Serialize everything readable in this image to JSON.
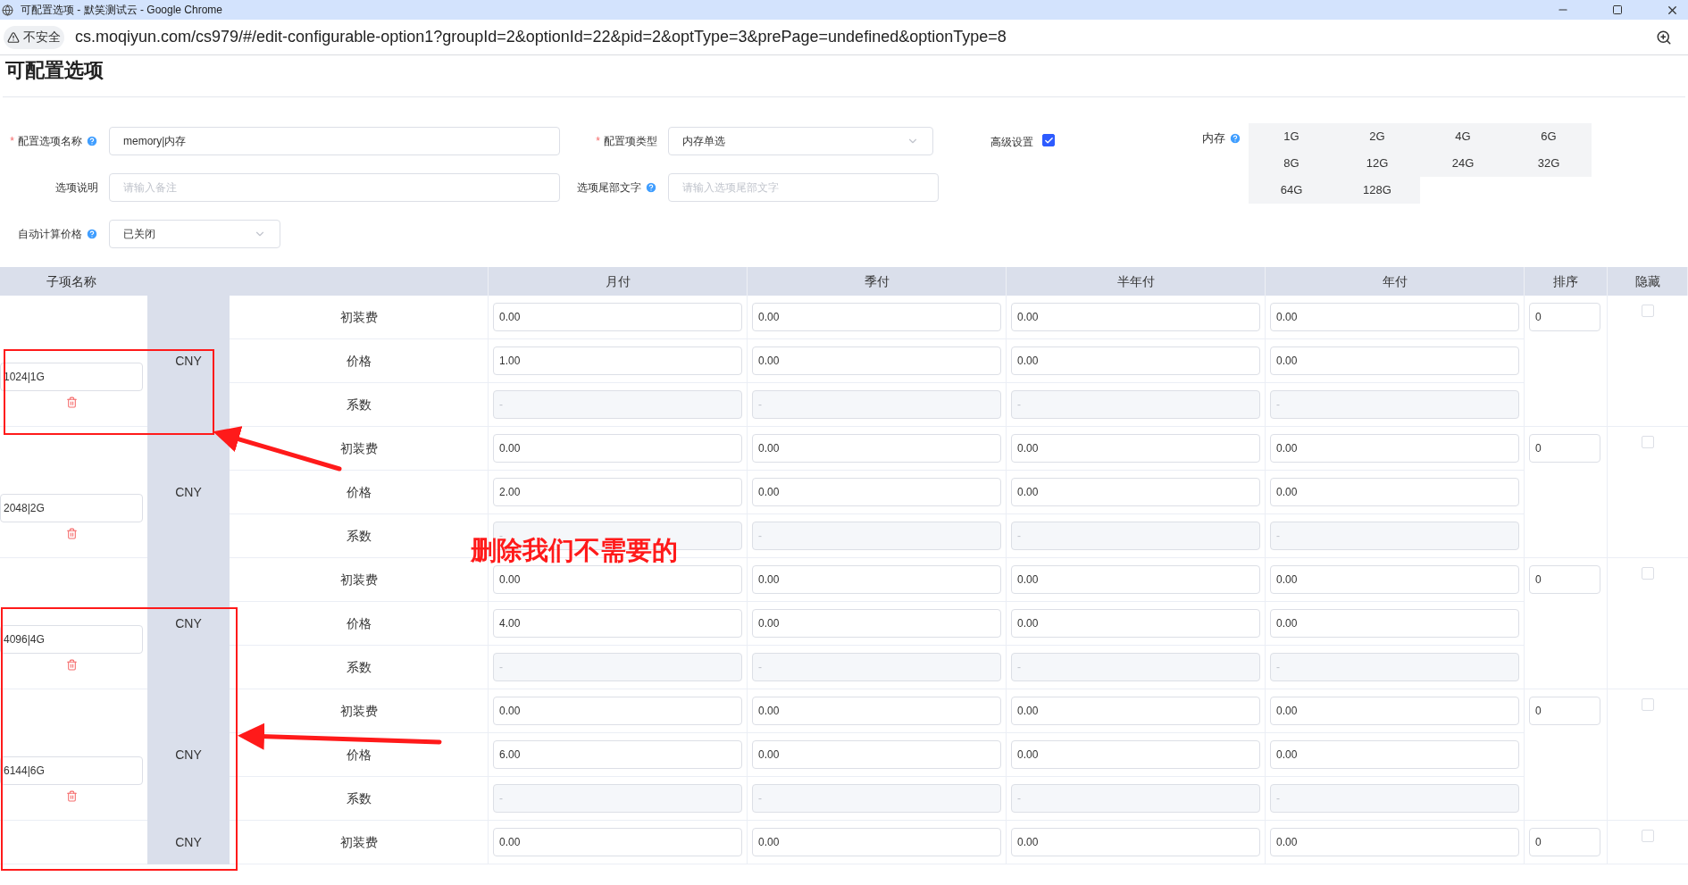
{
  "window": {
    "title": "可配置选项 - 默笑测试云 - Google Chrome"
  },
  "address_bar": {
    "security": "不安全",
    "url": "cs.moqiyun.com/cs979/#/edit-configurable-option1?groupId=2&optionId=22&pid=2&optType=3&prePage=undefined&optionType=8"
  },
  "page_title": "可配置选项",
  "form": {
    "name": {
      "label": "配置选项名称",
      "required_mark": "*",
      "value": "memory|内存"
    },
    "type": {
      "label": "配置项类型",
      "required_mark": "*",
      "value": "内存单选"
    },
    "advanced": {
      "label": "高级设置",
      "checked": true
    },
    "memory": {
      "label": "内存",
      "options": [
        "1G",
        "2G",
        "4G",
        "6G",
        "8G",
        "12G",
        "24G",
        "32G",
        "64G",
        "128G"
      ]
    },
    "description": {
      "label": "选项说明",
      "placeholder": "请输入备注"
    },
    "suffix": {
      "label": "选项尾部文字",
      "placeholder": "请输入选项尾部文字"
    },
    "auto_price": {
      "label": "自动计算价格",
      "value": "已关闭"
    }
  },
  "table": {
    "columns": [
      "子项名称",
      "月付",
      "季付",
      "半年付",
      "年付",
      "排序",
      "隐藏"
    ],
    "items": [
      {
        "name": "1024|1G",
        "currency": "CNY",
        "sort": "0",
        "hidden": false,
        "rows": [
          {
            "label": "初装费",
            "disabled": false,
            "values": [
              "0.00",
              "0.00",
              "0.00",
              "0.00"
            ]
          },
          {
            "label": "价格",
            "disabled": false,
            "values": [
              "1.00",
              "0.00",
              "0.00",
              "0.00"
            ]
          },
          {
            "label": "系数",
            "disabled": true,
            "values": [
              "-",
              "-",
              "-",
              "-"
            ]
          }
        ]
      },
      {
        "name": "2048|2G",
        "currency": "CNY",
        "sort": "0",
        "hidden": false,
        "rows": [
          {
            "label": "初装费",
            "disabled": false,
            "values": [
              "0.00",
              "0.00",
              "0.00",
              "0.00"
            ]
          },
          {
            "label": "价格",
            "disabled": false,
            "values": [
              "2.00",
              "0.00",
              "0.00",
              "0.00"
            ]
          },
          {
            "label": "系数",
            "disabled": true,
            "values": [
              "-",
              "-",
              "-",
              "-"
            ]
          }
        ]
      },
      {
        "name": "4096|4G",
        "currency": "CNY",
        "sort": "0",
        "hidden": false,
        "rows": [
          {
            "label": "初装费",
            "disabled": false,
            "values": [
              "0.00",
              "0.00",
              "0.00",
              "0.00"
            ]
          },
          {
            "label": "价格",
            "disabled": false,
            "values": [
              "4.00",
              "0.00",
              "0.00",
              "0.00"
            ]
          },
          {
            "label": "系数",
            "disabled": true,
            "values": [
              "-",
              "-",
              "-",
              "-"
            ]
          }
        ]
      },
      {
        "name": "6144|6G",
        "currency": "CNY",
        "sort": "0",
        "hidden": false,
        "rows": [
          {
            "label": "初装费",
            "disabled": false,
            "values": [
              "0.00",
              "0.00",
              "0.00",
              "0.00"
            ]
          },
          {
            "label": "价格",
            "disabled": false,
            "values": [
              "6.00",
              "0.00",
              "0.00",
              "0.00"
            ]
          },
          {
            "label": "系数",
            "disabled": true,
            "values": [
              "-",
              "-",
              "-",
              "-"
            ]
          }
        ]
      },
      {
        "currency": "CNY",
        "sort": "0",
        "hidden": false,
        "rows": [
          {
            "label": "初装费",
            "disabled": false,
            "values": [
              "0.00",
              "0.00",
              "0.00",
              "0.00"
            ]
          }
        ]
      }
    ]
  },
  "annotation": {
    "label": "删除我们不需要的"
  }
}
